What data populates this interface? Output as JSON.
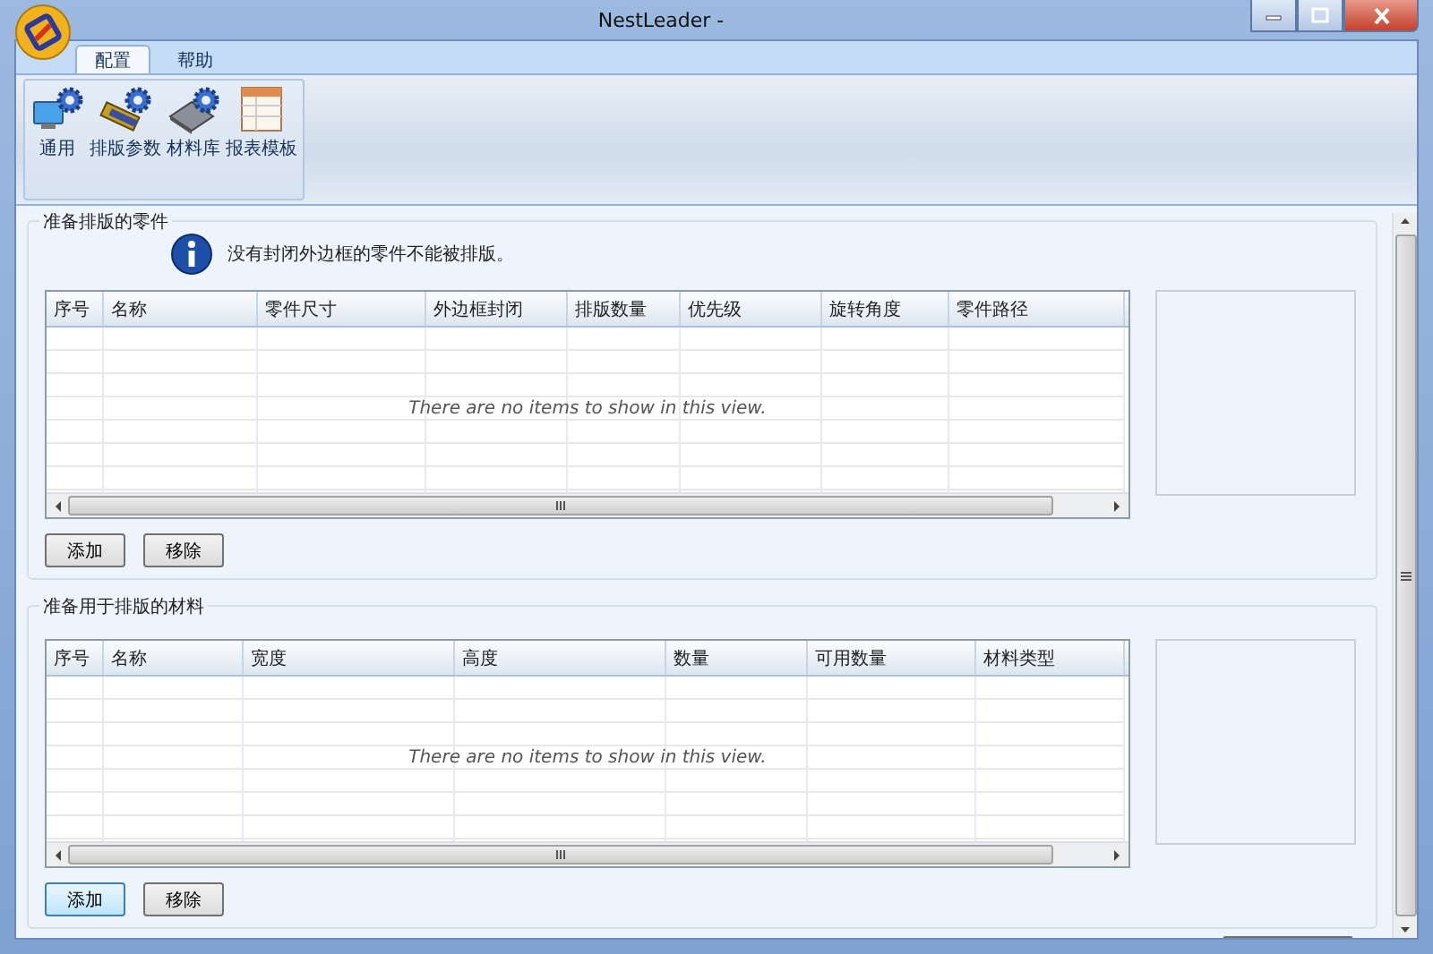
{
  "window": {
    "title": "NestLeader -"
  },
  "tabs": [
    {
      "label": "配置",
      "selected": true
    },
    {
      "label": "帮助",
      "selected": false
    }
  ],
  "ribbon": {
    "items": [
      {
        "label": "通用",
        "kind": "general"
      },
      {
        "label": "排版参数",
        "kind": "nesting"
      },
      {
        "label": "材料库",
        "kind": "library"
      },
      {
        "label": "报表模板",
        "kind": "report"
      }
    ]
  },
  "sections": [
    {
      "title": "准备排版的零件",
      "notice": "没有封闭外边框的零件不能被排版。",
      "columns": [
        "序号",
        "名称",
        "零件尺寸",
        "外边框封闭",
        "排版数量",
        "优先级",
        "旋转角度",
        "零件路径"
      ],
      "empty_text": "There are no items to show in this view.",
      "buttons": [
        {
          "label": "添加",
          "focused": false
        },
        {
          "label": "移除",
          "focused": false
        }
      ]
    },
    {
      "title": "准备用于排版的材料",
      "columns": [
        "序号",
        "名称",
        "宽度",
        "高度",
        "数量",
        "可用数量",
        "材料类型"
      ],
      "empty_text": "There are no items to show in this view.",
      "buttons": [
        {
          "label": "添加",
          "focused": true
        },
        {
          "label": "移除",
          "focused": false
        }
      ]
    }
  ]
}
